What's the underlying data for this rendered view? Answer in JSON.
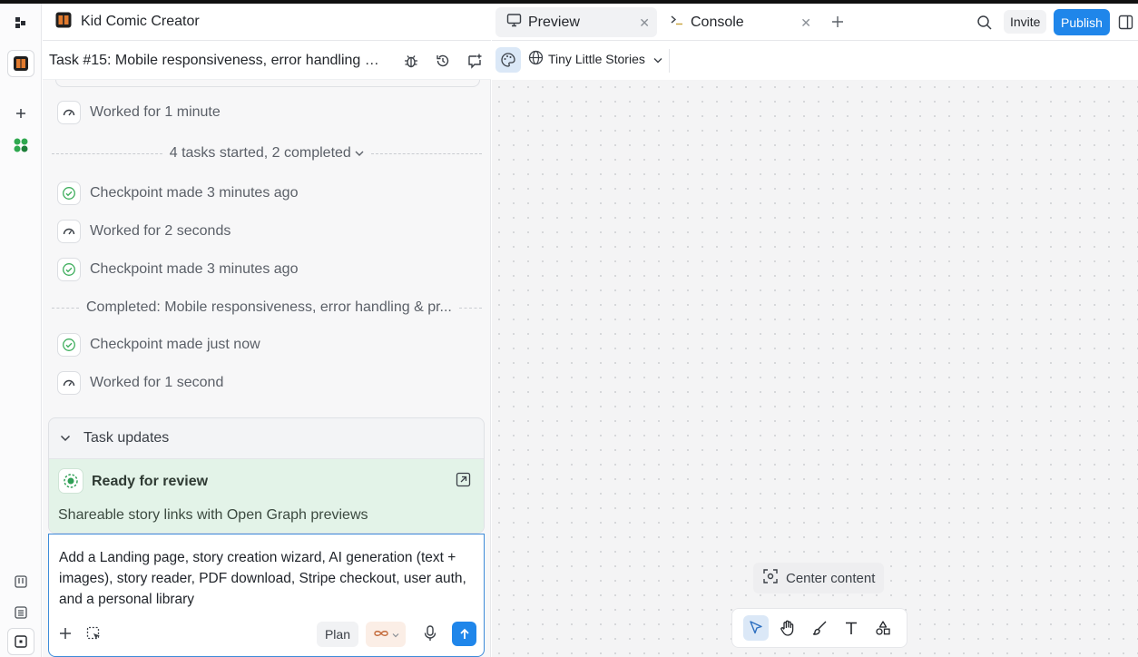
{
  "app": {
    "title": "Kid Comic Creator"
  },
  "task": {
    "title": "Task #15: Mobile responsiveness, error handling & ..."
  },
  "activity": {
    "worked_1": "Worked for 1 minute",
    "tasks_summary": "4 tasks started, 2 completed",
    "checkpoint_1": "Checkpoint made 3 minutes ago",
    "worked_2": "Worked for 2 seconds",
    "checkpoint_2": "Checkpoint made 3 minutes ago",
    "completed": "Completed: Mobile responsiveness, error handling & pr...",
    "checkpoint_3": "Checkpoint made just now",
    "worked_3": "Worked for 1 second"
  },
  "updates": {
    "header": "Task updates",
    "status": "Ready for review",
    "description": "Shareable story links with Open Graph previews"
  },
  "composer": {
    "text": "Add a Landing page, story creation wizard, AI generation (text + images), story reader, PDF download, Stripe checkout, user auth, and a personal library",
    "plan_label": "Plan"
  },
  "tabs": [
    {
      "label": "Preview"
    },
    {
      "label": "Console"
    }
  ],
  "header": {
    "invite_label": "Invite",
    "publish_label": "Publish"
  },
  "preview": {
    "site_name": "Tiny Little Stories",
    "center_label": "Center content"
  },
  "colors": {
    "accent": "#1f86ea",
    "review_bg": "#e3f3e8",
    "success": "#3fae5d"
  }
}
